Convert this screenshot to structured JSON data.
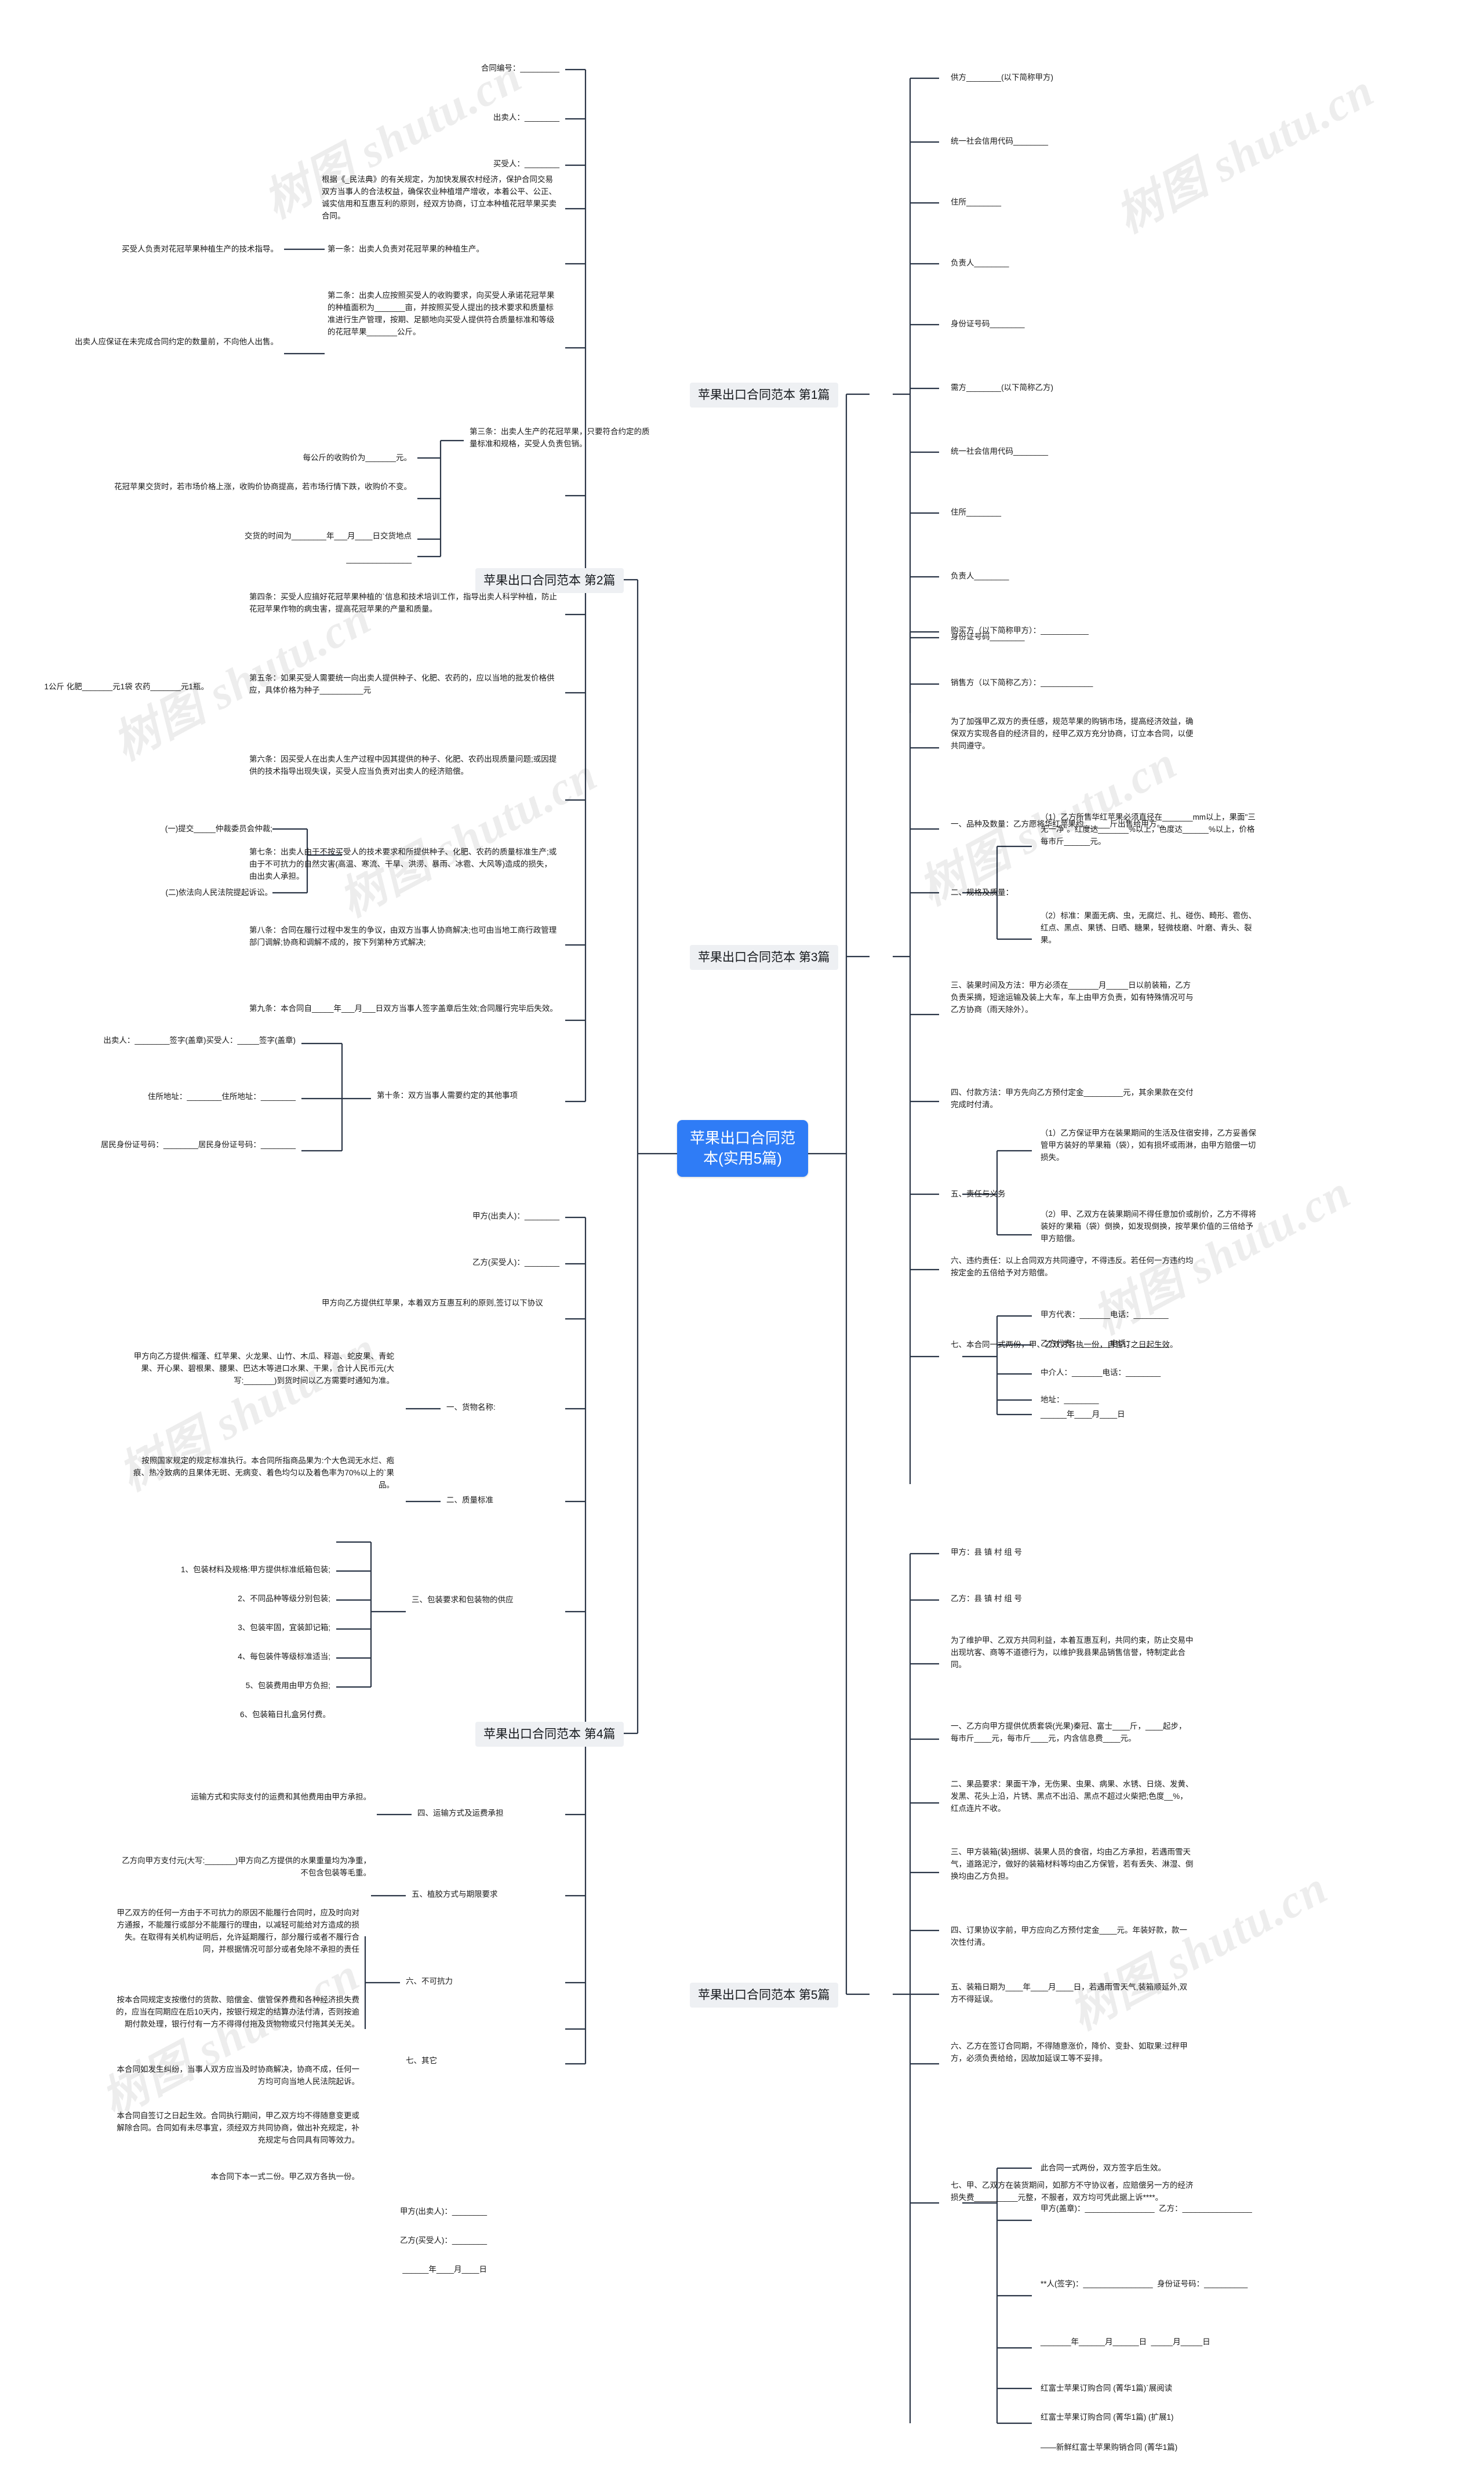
{
  "meta": {
    "watermark": "树图 shutu.cn",
    "accent": "#2f7cf6",
    "topic_bg": "#eef0f3",
    "link_color": "#2b3647"
  },
  "root": {
    "label": "苹果出口合同范本(实用5篇)"
  },
  "topics": {
    "p1": "苹果出口合同范本 第1篇",
    "p2": "苹果出口合同范本 第2篇",
    "p3": "苹果出口合同范本 第3篇",
    "p4": "苹果出口合同范本 第4篇",
    "p5": "苹果出口合同范本 第5篇"
  },
  "piece1": [
    "供方________(以下简称甲方)",
    "统一社会信用代码________",
    "住所________",
    "负责人________",
    "身份证号码________",
    "需方________(以下简称乙方)",
    "统一社会信用代码________",
    "住所________",
    "负责人________",
    "身份证号码________"
  ],
  "piece2": {
    "n_head_1": "合同编号：_________",
    "n_head_2": "出卖人：________",
    "n_head_3": "买受人：________",
    "n_head_4": "根据《_民法典》的有关规定，为加快发展农村经济，保护合同交易双方当事人的合法权益，确保农业种植增产增收，本着公平、公正、诚实信用和互惠互利的原则，经双方协商，订立本种植花冠苹果买卖合同。",
    "a1_label": "第一条：出卖人负责对花冠苹果的种植生产。",
    "a1_sub": "买受人负责对花冠苹果种植生产的技术指导。",
    "a2_label": "第二条：出卖人应按照买受人的收购要求，向买受人承诺花冠苹果的种植面积为_______亩，并按照买受人提出的技术要求和质量标准进行生产管理，按期、足额地向买受人提供符合质量标准和等级的花冠苹果_______公斤。",
    "a2_sub": "出卖人应保证在未完成合同约定的数量前，不向他人出售。",
    "a3_label": "第三条：出卖人生产的花冠苹果，只要符合约定的质量标准和规格，买受人负责包销。",
    "a3_sub1": "每公斤的收购价为_______元。",
    "a3_sub2": "花冠苹果交货时，若市场价格上涨，收购价协商提高，若市场行情下跌，收购价不变。",
    "a3_sub3": "交货的时间为________年___月____日交货地点",
    "a3_sub4": "_______________",
    "a4_label": "第四条：买受人应搞好花冠苹果种植的`信息和技术培训工作，指导出卖人科学种植，防止花冠苹果作物的病虫害，提高花冠苹果的产量和质量。",
    "a5_label": "第五条：如果买受人需要统一向出卖人提供种子、化肥、农药的，应以当地的批发价格供应，具体价格为种子__________元",
    "a5_sub": "1公斤 化肥_______元1袋 农药_______元1瓶。",
    "a6_label": "第六条：因买受人在出卖人生产过程中因其提供的种子、化肥、农药出现质量问题;或因提供的技术指导出现失误，买受人应当负责对出卖人的经济赔偿。",
    "a7_label": "第七条：出卖人由于不按买受人的技术要求和所提供种子、化肥、农药的质量标准生产;或由于不可抗力的自然灾害(高温、寒流、干旱、洪涝、暴雨、冰雹、大风等)造成的损失，由出卖人承担。",
    "a8_label": "第八条：合同在履行过程中发生的争议，由双方当事人协商解决;也可由当地工商行政管理部门调解;协商和调解不成的，按下列第种方式解决;",
    "a8_sub1": "(一)提交_____仲裁委员会仲裁;",
    "a8_sub2": "(二)依法向人民法院提起诉讼。",
    "a9_label": "第九条：本合同自_____年___月___日双方当事人签字盖章后生效;合同履行完毕后失效。",
    "a10_label": "第十条：双方当事人需要约定的其他事项",
    "a10_sub1": "出卖人：________签字(盖章)买受人：_____签字(盖章)",
    "a10_sub2": "住所地址：________住所地址：________",
    "a10_sub3": "居民身份证号码：________居民身份证号码：________"
  },
  "piece3": {
    "buyer": "购买方（以下简称甲方）：___________",
    "seller": "销售方（以下简称乙方）：____________",
    "preamble": "为了加强甲乙双方的责任感，规范苹果的购销市场，提高经济效益，确保双方实现各自的经济目的，经甲乙双方充分协商，订立本合同，以便共同遵守。",
    "s1": "一、品种及数量：乙方愿将华红苹果约______斤出售给甲方。",
    "s2_label": "二、规格及质量：",
    "s2_1": "（1）乙方所售华红苹果必须直径在_______mm以上，果面\"三无一净\"。红度达_______%以上，色度达______%以上，价格每市斤______元。",
    "s2_2": "（2）标准：果面无病、虫，无腐烂、扎、碰伤、畸形、雹伤、红点、黑点、果锈、日晒、糖果，轻微枝磨、叶磨、青头、裂果。",
    "s3": "三、装果时间及方法：甲方必须在_______月_____日以前装箱，乙方负责采摘，短途运输及装上大车，车上由甲方负责，如有特殊情况可与乙方协商（雨天除外）。",
    "s4": "四、付款方法：甲方先向乙方预付定金_________元，其余果款在交付完成时付清。",
    "s5_label": "五、责任与义务",
    "s5_1": "（1）乙方保证甲方在装果期间的生活及住宿安排，乙方妥善保管甲方装好的苹果箱（袋），如有损坏或雨淋，由甲方赔偿一切损失。",
    "s5_2": "（2）甲、乙双方在装果期间不得任意加价或削价，乙方不得将装好的'果箱（袋）倒换，如发现倒换，按苹果价值的三倍给予甲方赔偿。",
    "s6": "六、违约责任：以上合同双方共同遵守，不得违反。若任何一方违约均按定金的五倍给予对方赔偿。",
    "s7_label": "七、本合同一式两份，甲、乙双方各执一份，自签订之日起生效。",
    "s7_1": "甲方代表：_______电话：________",
    "s7_2": "乙方代表：_______电话：________",
    "s7_3": "中介人：_______电话：________",
    "s7_4": "地址：________",
    "s7_5": "______年____月____日"
  },
  "piece4": {
    "h1": "甲方(出卖人)：________",
    "h2": "乙方(买受人)：________",
    "h3": "甲方向乙方提供红苹果，本着双方互惠互利的原则,签订以下协议",
    "s1_label": "一、货物名称:",
    "s1_text": "甲方向乙方提供:榴蓬、红苹果、火龙果、山竹、木瓜、释迦、蛇皮果、青蛇果、开心果、碧根果、腰果、巴达木等进口水果、干果，合计人民币元(大写:_______)到货时间以乙方需要时通知为准。",
    "s2_label": "二、质量标准",
    "s2_text": "按照国家规定的规定标准执行。本合同所指商品果为:个大色润无水烂、疱痕、热冷致病的且果体无斑、无病变、着色均匀以及着色率为70%以上的`果品。",
    "s3_label": "三、包装要求和包装物的供应",
    "s3_items": [
      "1、包装材料及规格:甲方提供标准纸箱包装;",
      "2、不同品种等级分别包装;",
      "3、包装牢固，宜装卸记箱;",
      "4、每包装件等级标准适当;",
      "5、包装费用由甲方负担;",
      "6、包装箱日扎盒另付费。"
    ],
    "s4_label": "四、运输方式及运费承担",
    "s4_text": "运输方式和实际支付的运费和其他费用由甲方承担。",
    "s5_label": "五、植胶方式与期限要求",
    "s5_text": "乙方向甲方支付元(大写:_______)甲方向乙方提供的水果重量均为净重，不包含包装等毛重。",
    "s6_label": "六、不可抗力",
    "s6_text": "甲乙双方的任何一方由于不可抗力的原因不能履行合同时，应及时向对方通报，不能履行或部分不能履行的理由，以减轻可能给对方造成的损失。在取得有关机构证明后，允许延期履行，部分履行或者不履行合同，并根据情况可部分或者免除不承担的责任",
    "s7_label": "七、其它",
    "s7_items": [
      "按本合同规定支按缴付的货款、赔偿金、偿管保养费和各种经济损失费的，应当在同期应在后10天内，按银行规定的结算办法付清，否则按逾期付款处理，银行付有一方不得得付拖及货物物或只付拖其关无关。",
      "本合同如发生纠纷，当事人双方应当及时协商解决，协商不成，任何一方均可向当地人民法院起诉。",
      "本合同自签订之日起生效。合同执行期间，甲乙双方均不得随意变更或解除合同。合同如有未尽事宜，须经双方共同协商，做出补充规定，补充规定与合同具有同等效力。",
      "本合同下本一式二份。甲乙双方各执一份。"
    ],
    "f1": "甲方(出卖人)：________",
    "f2": "乙方(买受人)：________",
    "f3": "______年____月____日"
  },
  "piece5": {
    "h1": "甲方：县 镇 村 组 号",
    "h2": "乙方：县 镇 村 组 号",
    "preamble": "为了维护甲、乙双方共同利益，本着互惠互利，共同约束，防止交易中出现坑客、商等不道德行为，以维护我县果品销售信誉，特制定此合同。",
    "s1": "一、乙方向甲方提供优质套袋(光果)秦冠、富士____斤，____起步，每市斤____元，每市斤____元，内含信息费____元。",
    "s2": "二、果品要求：果面干净，无伤果、虫果、病果、水锈、日烧、发黄、发黑、花头上沿，片锈、黑点不出沿、黑点不超过火柴把;色度__%，红点连片不收。",
    "s3": "三、甲方装箱(装)捆绑、装果人员的食宿，均由乙方承担，若遇雨雪天气，道路泥泞，做好的装箱材料等均由乙方保管，若有丢失、淋湿、倒换均由乙方负担。",
    "s4": "四、订果协议字前，甲方应向乙方预付定金____元。年装好款，款一次性付清。",
    "s5": "五、装箱日期为____年____月____日，若遇雨雪天气,装箱顺延外,双方不得延误。",
    "s6": "六、乙方在签订合同期，不得随意涨价，降价、变卦、如取果:过秤甲方，必须负责给给，因故加延误工等不妥排。",
    "s7": "七、甲、乙双方在装货期间，如那方不守协议者，应赔偿另一方的经济损失费__________元整，不服者，双方均可凭此据上诉****。",
    "f_head": "此合同一式两份，双方签字后生效。",
    "f1": "甲方(盖章)：________________  乙方：________________",
    "f2": "**人(签字)：________________  身份证号码：__________",
    "f3": "_______年______月______日  _____月_____日",
    "t1": "红富士苹果订购合同 (菁华1篇)`展阅读",
    "t2": "红富士苹果订购合同 (菁华1篇) (扩展1)",
    "t3": "——新鲜红富士苹果购销合同 (菁华1篇)"
  }
}
